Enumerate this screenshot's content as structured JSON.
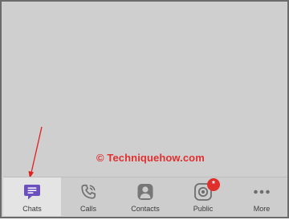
{
  "watermark": {
    "text": "© Techniquehow.com",
    "color": "#e03030"
  },
  "tabbar": {
    "active_color": "#6b4fbf",
    "badge_color": "#e0302c",
    "tabs": [
      {
        "label": "Chats",
        "icon": "chat-bubble-icon",
        "active": true
      },
      {
        "label": "Calls",
        "icon": "phone-icon"
      },
      {
        "label": "Contacts",
        "icon": "person-icon"
      },
      {
        "label": "Public",
        "icon": "public-accounts-icon",
        "badge": "*"
      },
      {
        "label": "More",
        "icon": "more-dots-icon"
      }
    ]
  }
}
